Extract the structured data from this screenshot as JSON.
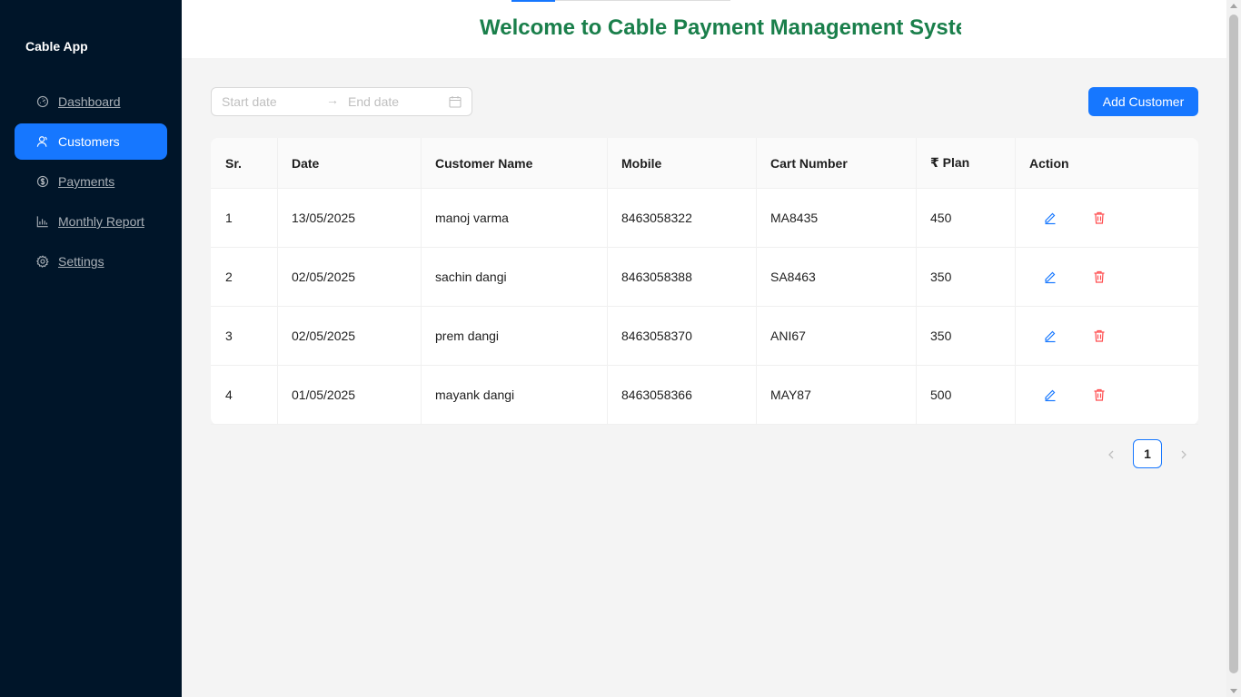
{
  "sidebar": {
    "brand": "Cable App",
    "items": [
      {
        "label": "Dashboard",
        "icon": "dashboard-icon"
      },
      {
        "label": "Customers",
        "icon": "customers-icon",
        "active": true
      },
      {
        "label": "Payments",
        "icon": "dollar-icon"
      },
      {
        "label": "Monthly Report",
        "icon": "bar-chart-icon"
      },
      {
        "label": "Settings",
        "icon": "gear-icon"
      }
    ]
  },
  "header": {
    "title": "Welcome to Cable Payment Management System"
  },
  "filters": {
    "start_placeholder": "Start date",
    "end_placeholder": "End date",
    "arrow": "→"
  },
  "toolbar": {
    "add_label": "Add Customer"
  },
  "table": {
    "columns": [
      "Sr.",
      "Date",
      "Customer Name",
      "Mobile",
      "Cart Number",
      "₹ Plan",
      "Action"
    ],
    "rows": [
      [
        "1",
        "13/05/2025",
        "manoj varma",
        "8463058322",
        "MA8435",
        "450"
      ],
      [
        "2",
        "02/05/2025",
        "sachin dangi",
        "8463058388",
        "SA8463",
        "350"
      ],
      [
        "3",
        "02/05/2025",
        "prem dangi",
        "8463058370",
        "ANI67",
        "350"
      ],
      [
        "4",
        "01/05/2025",
        "mayank dangi",
        "8463058366",
        "MAY87",
        "500"
      ]
    ]
  },
  "pagination": {
    "prev": "‹",
    "current": "1",
    "next": "›"
  },
  "colors": {
    "sidebar_bg": "#001529",
    "accent": "#1677ff",
    "title": "#1a7f4b",
    "delete": "#ff4d4f"
  }
}
